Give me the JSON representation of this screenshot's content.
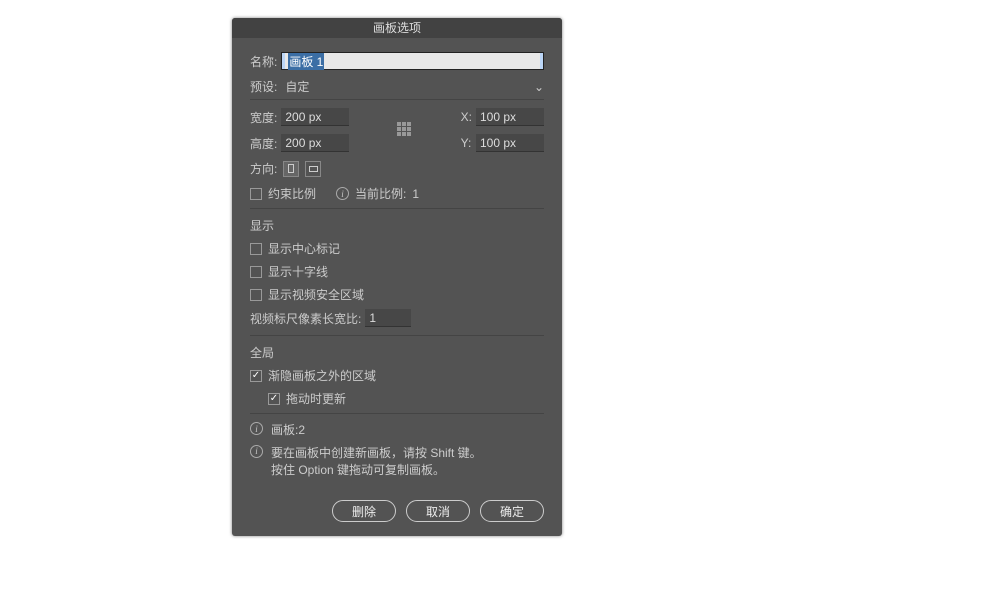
{
  "title": "画板选项",
  "name": {
    "label": "名称:",
    "value": "画板 1"
  },
  "preset": {
    "label": "预设:",
    "value": "自定"
  },
  "width": {
    "label": "宽度:",
    "value": "200 px"
  },
  "height": {
    "label": "高度:",
    "value": "200 px"
  },
  "x": {
    "label": "X:",
    "value": "100 px"
  },
  "y": {
    "label": "Y:",
    "value": "100 px"
  },
  "orientation_label": "方向:",
  "constrain": {
    "label": "约束比例",
    "checked": false
  },
  "current_ratio": {
    "label": "当前比例:",
    "value": "1"
  },
  "display": {
    "title": "显示",
    "center_mark": {
      "label": "显示中心标记",
      "checked": false
    },
    "crosshairs": {
      "label": "显示十字线",
      "checked": false
    },
    "video_safe": {
      "label": "显示视频安全区域",
      "checked": false
    },
    "pixel_aspect": {
      "label": "视频标尺像素长宽比:",
      "value": "1"
    }
  },
  "global": {
    "title": "全局",
    "fade_outside": {
      "label": "渐隐画板之外的区域",
      "checked": true
    },
    "update_drag": {
      "label": "拖动时更新",
      "checked": true
    }
  },
  "info": {
    "artboards_label": "画板:",
    "artboards_count": "2",
    "help1": "要在画板中创建新画板，请按 Shift 键。",
    "help2": "按住 Option 键拖动可复制画板。"
  },
  "buttons": {
    "delete": "删除",
    "cancel": "取消",
    "ok": "确定"
  }
}
